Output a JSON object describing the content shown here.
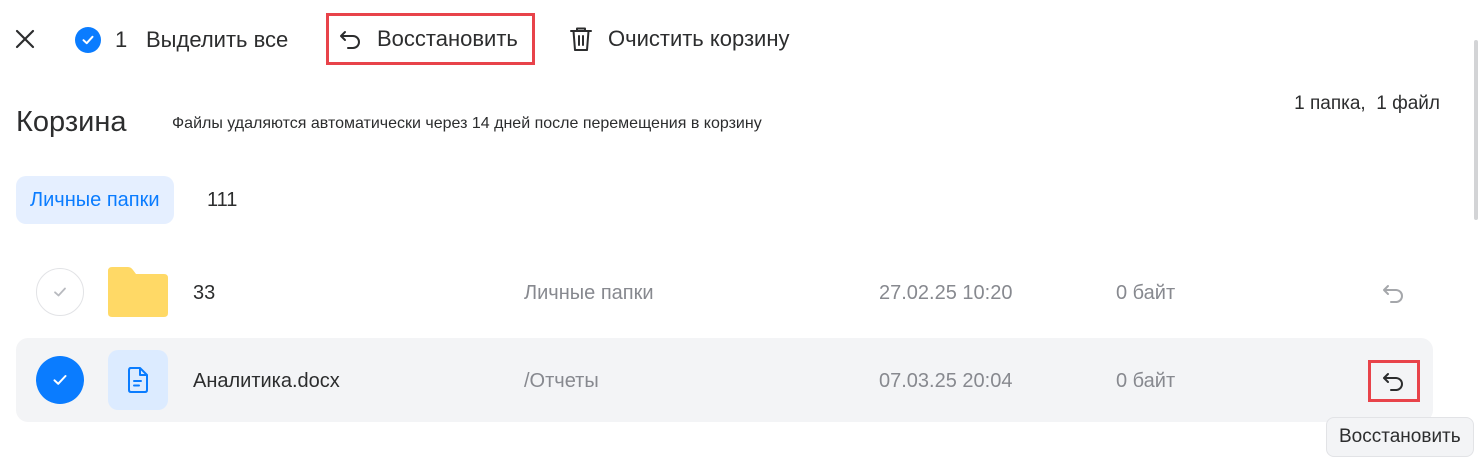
{
  "toolbar": {
    "selected_count": "1",
    "select_all_label": "Выделить все",
    "restore_label": "Восстановить",
    "clear_trash_label": "Очистить корзину"
  },
  "header": {
    "title": "Корзина",
    "subtitle": "Файлы удаляются автоматически через 14 дней после перемещения в корзину",
    "summary": "1 папка,  1 файл"
  },
  "breadcrumbs": {
    "chip_label": "Личные папки",
    "current": "111"
  },
  "items": [
    {
      "name": "33",
      "type_icon": "folder-icon",
      "path": "Личные папки",
      "date": "27.02.25 10:20",
      "size": "0 байт",
      "selected": false
    },
    {
      "name": "Аналитика.docx",
      "type_icon": "document-icon",
      "path": "/Отчеты",
      "date": "07.03.25 20:04",
      "size": "0 байт",
      "selected": true
    }
  ],
  "tooltip": {
    "text": "Восстановить"
  },
  "colors": {
    "accent": "#0a7cff",
    "highlight_border": "#e8434a",
    "selected_row_bg": "#f3f4f6",
    "chip_bg": "#e5efff",
    "folder": "#ffd966",
    "muted_text": "#87898f"
  }
}
